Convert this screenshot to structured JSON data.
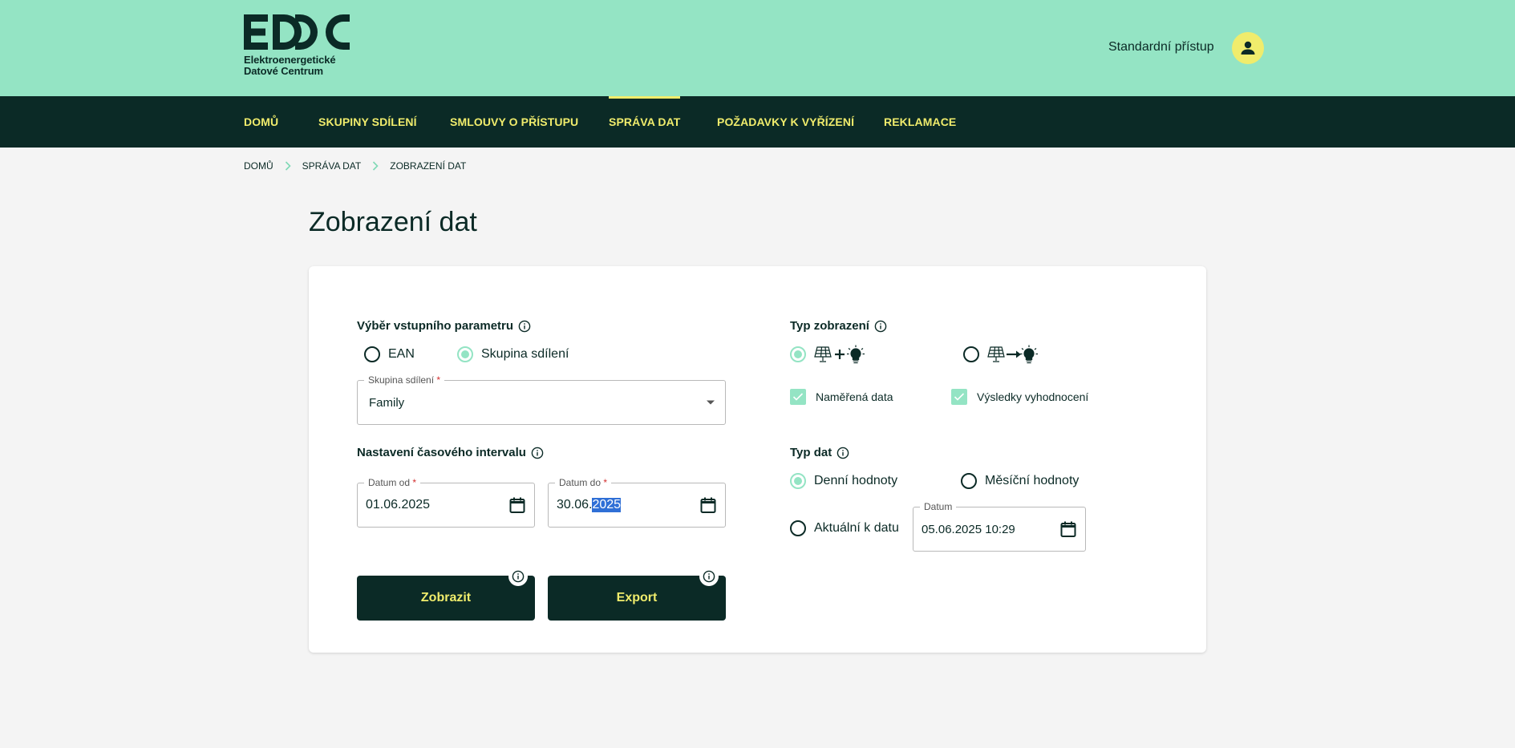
{
  "header": {
    "logo_mark": "EDC",
    "logo_line1": "Elektroenergetické",
    "logo_line2": "Datové Centrum",
    "access_label": "Standardní přístup",
    "avatar_icon": "person-icon"
  },
  "nav": {
    "items": [
      {
        "label": "DOMŮ"
      },
      {
        "label": "SKUPINY SDÍLENÍ"
      },
      {
        "label": "SMLOUVY O PŘÍSTUPU"
      },
      {
        "label": "SPRÁVA DAT"
      },
      {
        "label": "POŽADAVKY K VYŘÍZENÍ"
      },
      {
        "label": "REKLAMACE"
      }
    ],
    "active": "SPRÁVA DAT"
  },
  "breadcrumb": [
    "DOMŮ",
    "SPRÁVA DAT",
    "ZOBRAZENÍ DAT"
  ],
  "page_title": "Zobrazení dat",
  "form": {
    "input_param": {
      "label": "Výběr vstupního parametru",
      "options": [
        "EAN",
        "Skupina sdílení"
      ],
      "selected": "Skupina sdílení"
    },
    "group_select": {
      "label": "Skupina sdílení",
      "required_mark": "*",
      "value": "Family"
    },
    "interval": {
      "label": "Nastavení časového intervalu",
      "from_label": "Datum od",
      "from_value": "01.06.2025",
      "to_label": "Datum do",
      "to_value_prefix": "30.06.",
      "to_value_selected": "2025",
      "required_mark": "*"
    },
    "buttons": {
      "show_label": "Zobrazit",
      "export_label": "Export"
    },
    "view_type": {
      "label": "Typ zobrazení",
      "options": [
        "production-plus-consumption",
        "production-to-consumption"
      ],
      "selected": "production-plus-consumption",
      "checkboxes": [
        {
          "label": "Naměřená data",
          "checked": true
        },
        {
          "label": "Výsledky vyhodnocení",
          "checked": true
        }
      ]
    },
    "data_type": {
      "label": "Typ dat",
      "options": [
        "Denní hodnoty",
        "Měsíční hodnoty",
        "Aktuální k datu"
      ],
      "selected": "Denní hodnoty",
      "date_label": "Datum",
      "date_value": "05.06.2025 10:29"
    }
  },
  "colors": {
    "mint": "#94e4c4",
    "dark": "#0b2a26",
    "yellow": "#f0ec6c"
  }
}
